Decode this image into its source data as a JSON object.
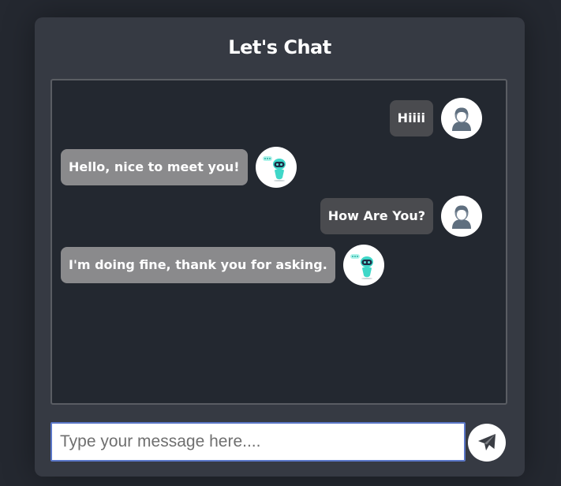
{
  "header": {
    "title": "Let's Chat"
  },
  "messages": [
    {
      "sender": "user",
      "text": "Hiiii",
      "avatar": "user-avatar-icon"
    },
    {
      "sender": "bot",
      "text": "Hello, nice to meet you!",
      "avatar": "robot-avatar-icon"
    },
    {
      "sender": "user",
      "text": "How Are You?",
      "avatar": "user-avatar-icon"
    },
    {
      "sender": "bot",
      "text": "I'm doing fine, thank you for asking.",
      "avatar": "robot-avatar-icon"
    }
  ],
  "composer": {
    "placeholder": "Type your message here....",
    "value": "",
    "send_icon": "paper-plane-icon"
  },
  "colors": {
    "page_background": "#242830",
    "card_background": "#363a43",
    "chat_background": "#232830",
    "user_bubble": "#4a4b4f",
    "bot_bubble": "#8a8a8c",
    "input_border": "#5b77c8"
  }
}
